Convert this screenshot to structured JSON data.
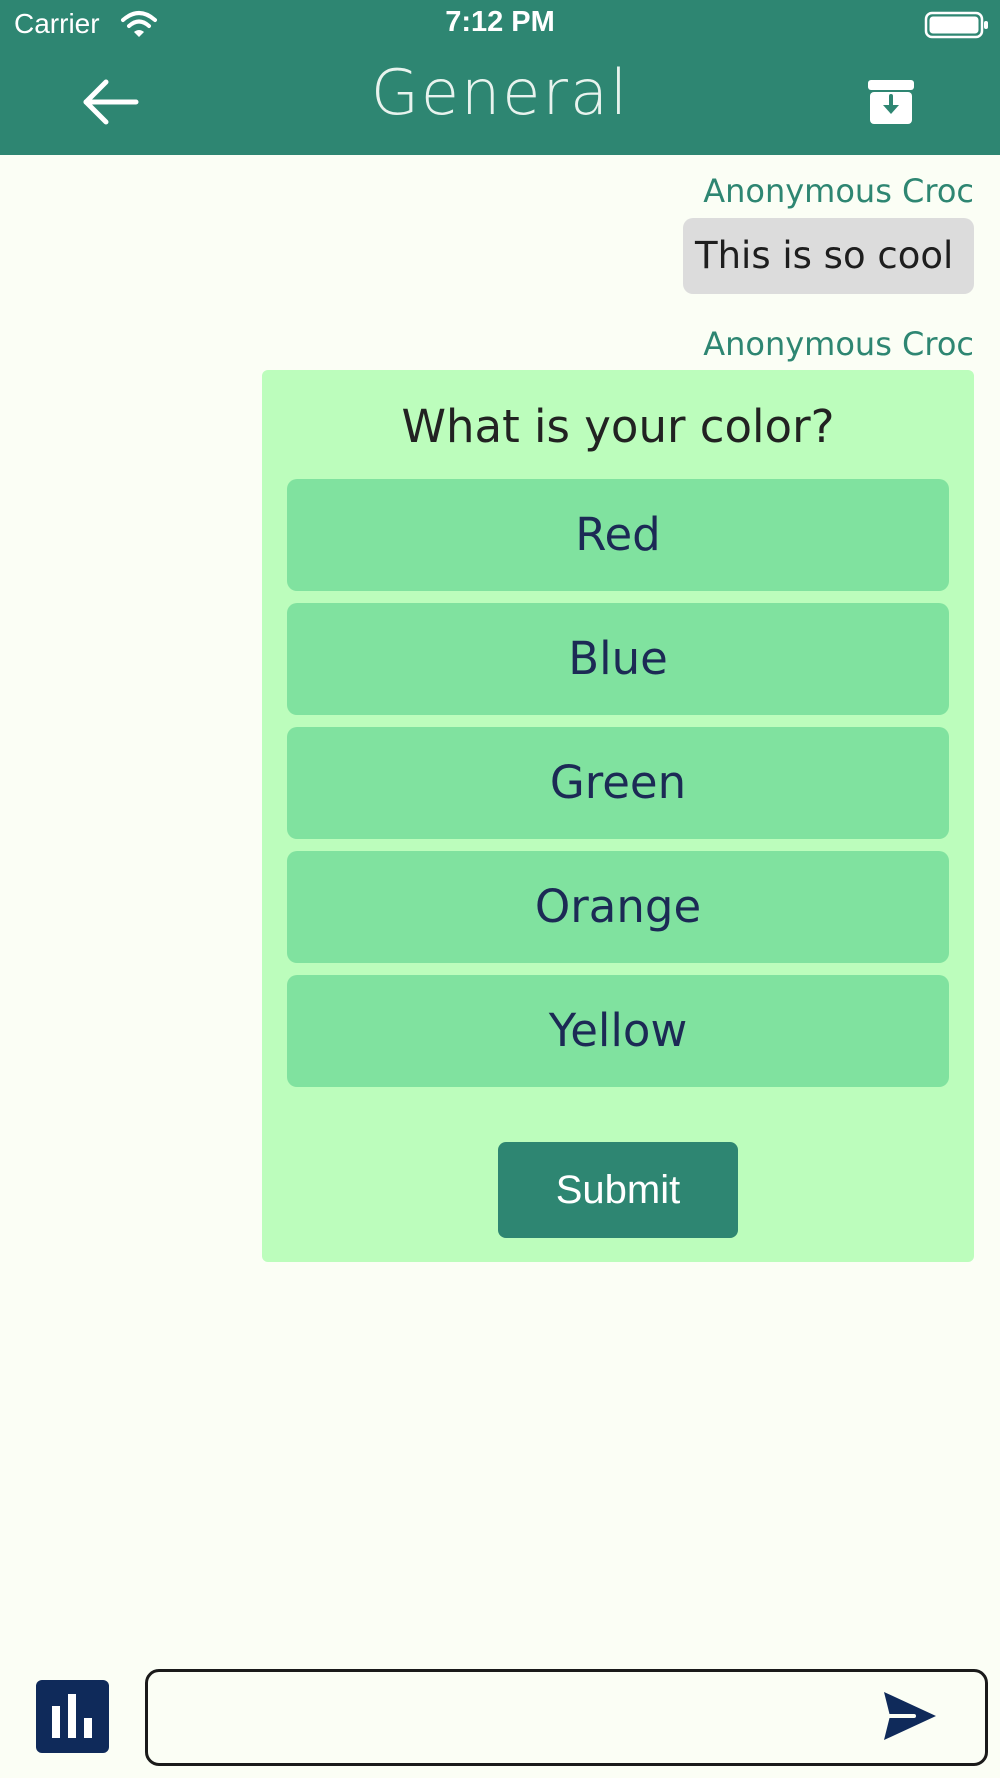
{
  "status_bar": {
    "carrier": "Carrier",
    "time": "7:12 PM",
    "wifi_icon": "wifi-icon",
    "battery_icon": "battery-full-icon"
  },
  "nav": {
    "title": "General",
    "back_icon": "arrow-left-icon",
    "archive_icon": "archive-download-icon"
  },
  "messages": [
    {
      "sender": "Anonymous Croc",
      "text": "This is so cool"
    },
    {
      "sender": "Anonymous Croc",
      "poll": {
        "question": "What is your color?",
        "options": [
          "Red",
          "Blue",
          "Green",
          "Orange",
          "Yellow"
        ],
        "submit_label": "Submit"
      }
    }
  ],
  "composer": {
    "value": "",
    "placeholder": "",
    "poll_icon": "bar-chart-icon",
    "send_icon": "send-icon"
  },
  "colors": {
    "header": "#2e8672",
    "background": "#fbfef5",
    "poll_card": "#bcfdbc",
    "poll_option": "#80e29f",
    "submit": "#2e8672",
    "bubble": "#dcdcdc",
    "poll_tool": "#0f2a5a"
  }
}
